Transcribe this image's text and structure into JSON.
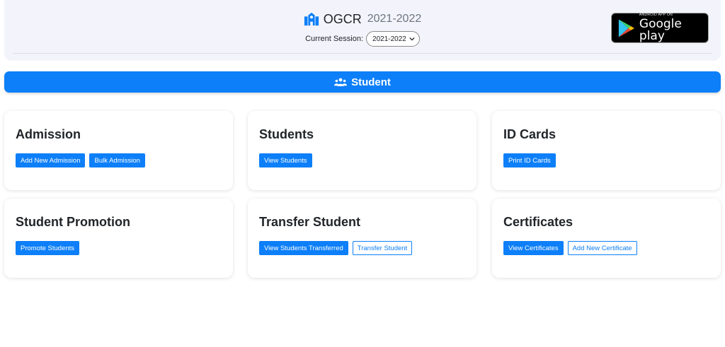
{
  "header": {
    "app_name": "OGCR",
    "year": "2021-2022",
    "session_label": "Current Session:",
    "session_value": "2021-2022",
    "store_badge": {
      "small_text": "ANDROID APP ON",
      "big_text": "Google play"
    }
  },
  "section": {
    "title": "Student"
  },
  "cards": [
    {
      "title": "Admission",
      "buttons": [
        {
          "label": "Add New Admission",
          "style": "primary"
        },
        {
          "label": "Bulk Admission",
          "style": "primary"
        }
      ]
    },
    {
      "title": "Students",
      "buttons": [
        {
          "label": "View Students",
          "style": "primary"
        }
      ]
    },
    {
      "title": "ID Cards",
      "buttons": [
        {
          "label": "Print ID Cards",
          "style": "primary"
        }
      ]
    },
    {
      "title": "Student Promotion",
      "buttons": [
        {
          "label": "Promote Students",
          "style": "primary"
        }
      ]
    },
    {
      "title": "Transfer Student",
      "buttons": [
        {
          "label": "View Students Transferred",
          "style": "primary"
        },
        {
          "label": "Transfer Student",
          "style": "outline"
        }
      ]
    },
    {
      "title": "Certificates",
      "buttons": [
        {
          "label": "View Certificates",
          "style": "primary"
        },
        {
          "label": "Add New Certificate",
          "style": "outline"
        }
      ]
    }
  ],
  "colors": {
    "primary": "#0d7ff8",
    "header_bg": "#f3f4fb"
  }
}
